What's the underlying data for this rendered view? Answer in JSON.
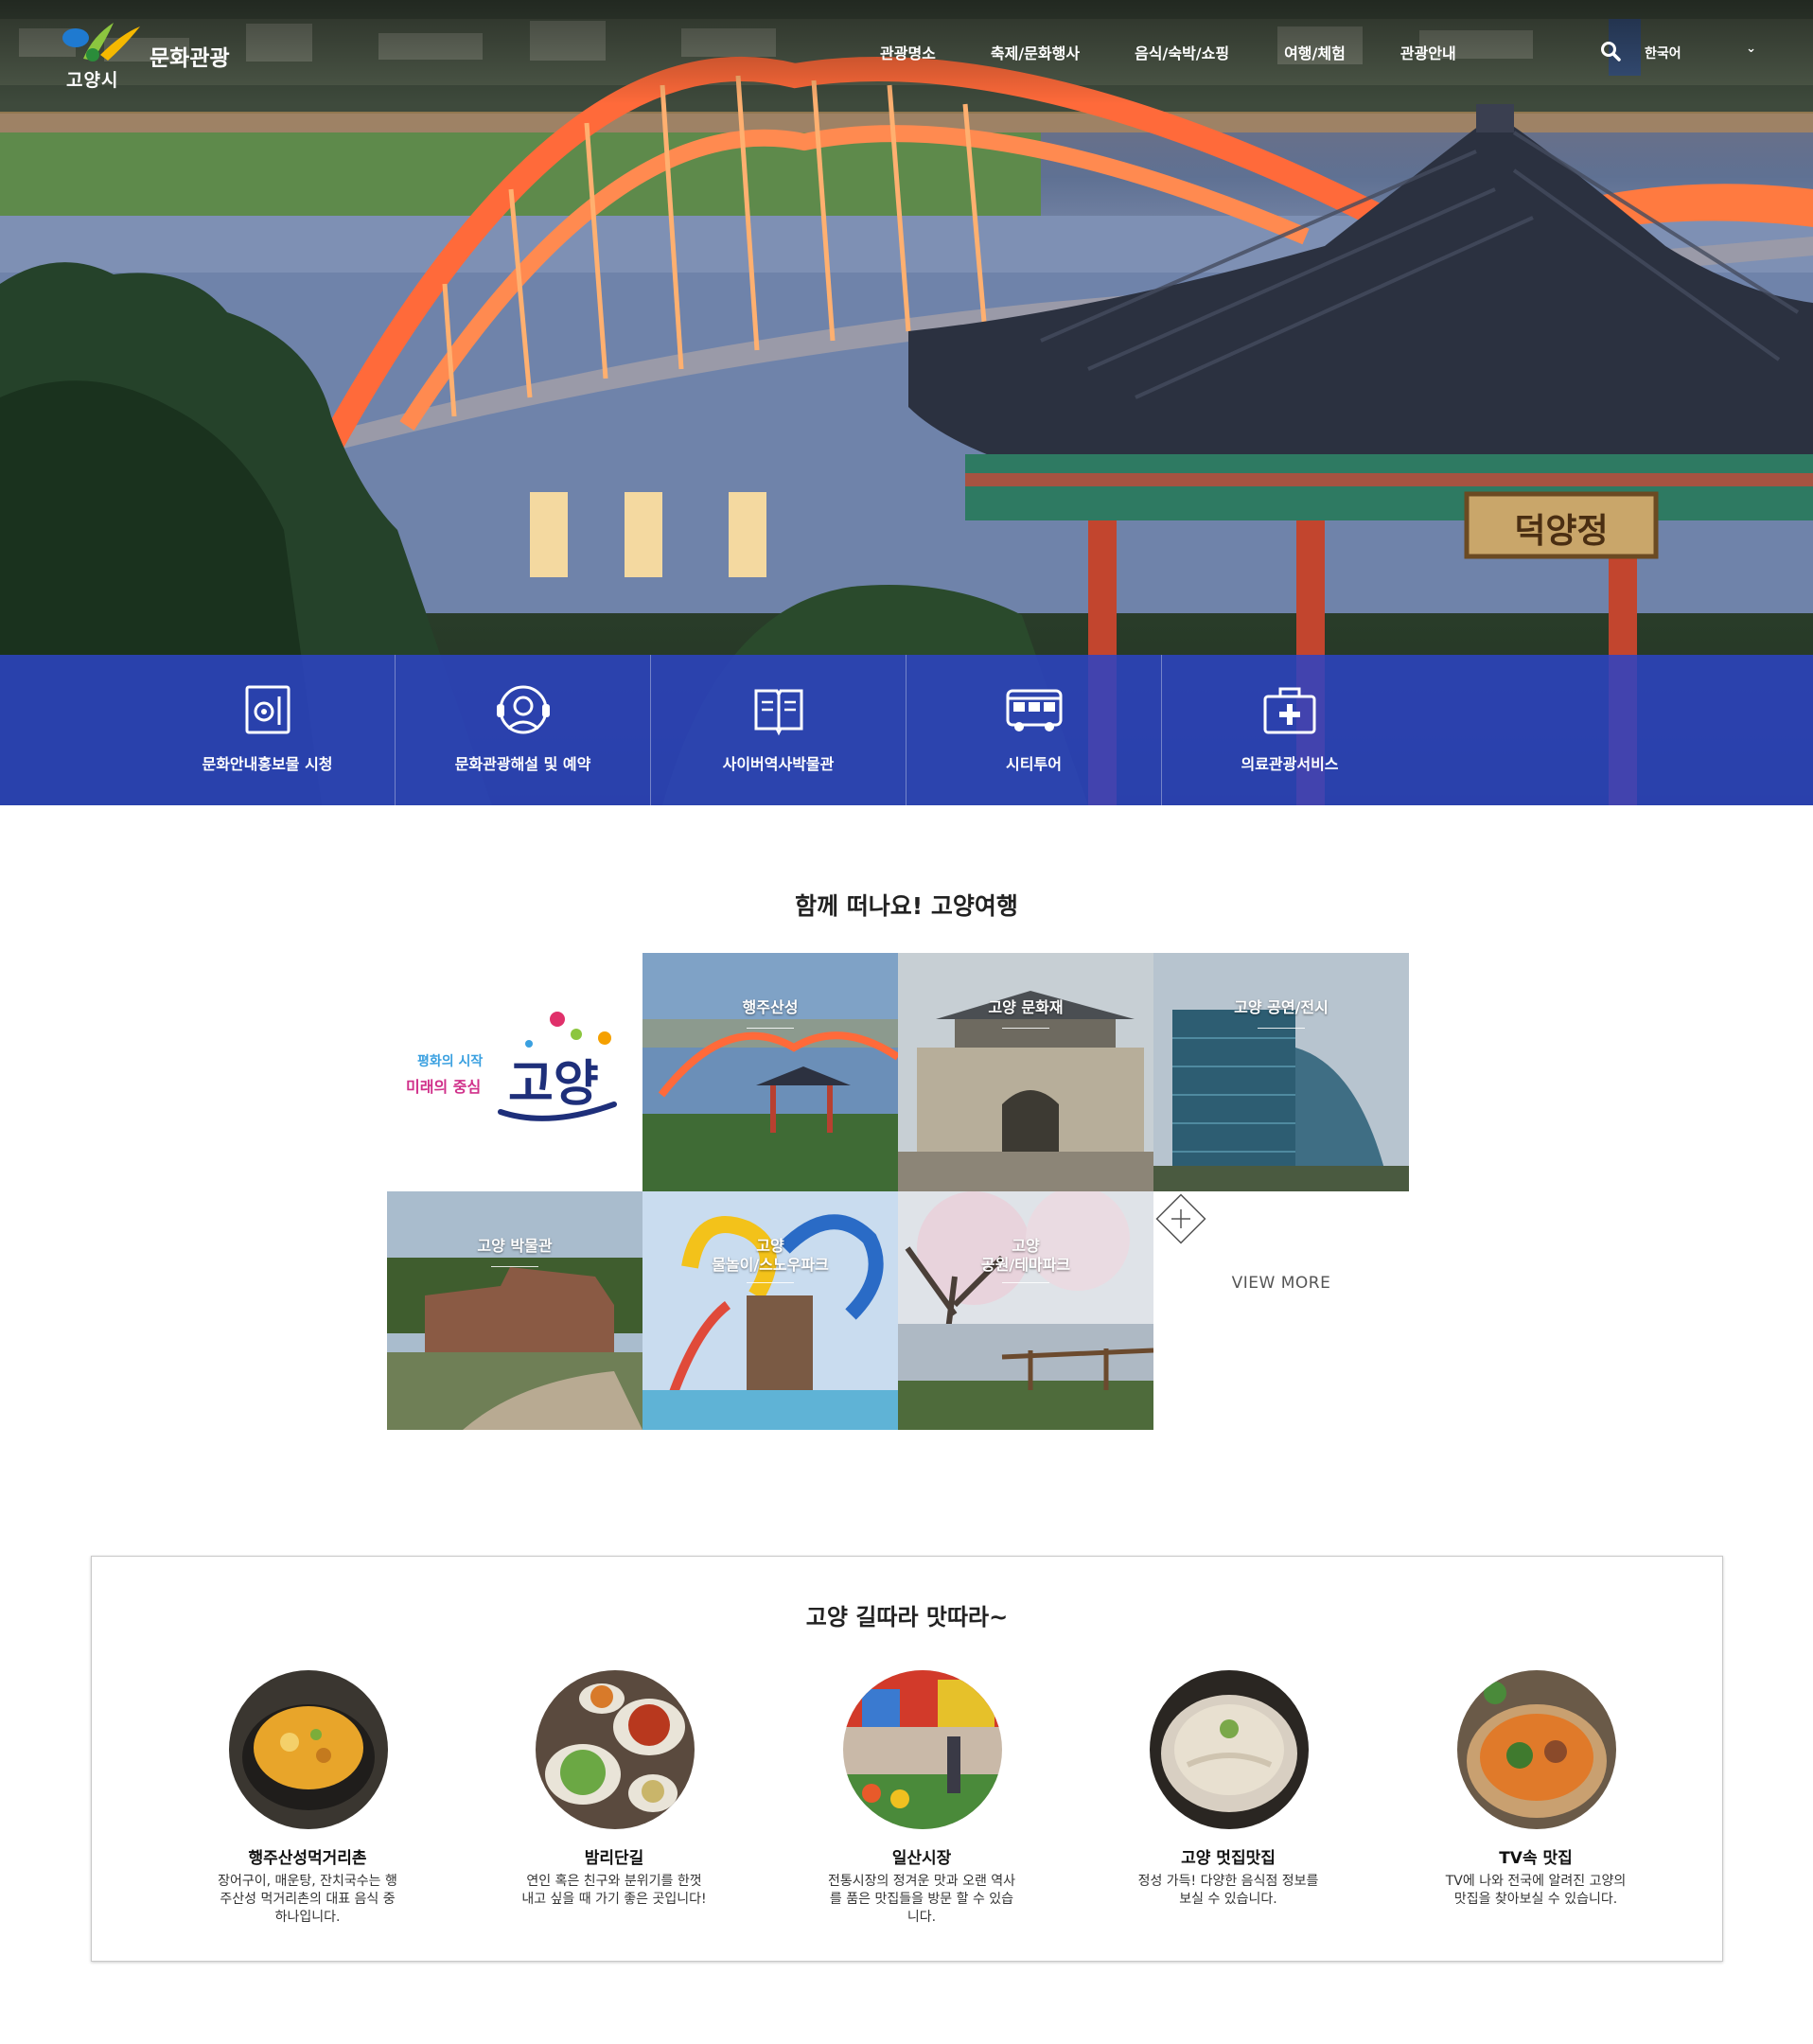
{
  "header": {
    "logo_city": "고양시",
    "site_title": "문화관광",
    "nav": [
      "관광명소",
      "축제/문화행사",
      "음식/숙박/쇼핑",
      "여행/체험",
      "관광안내"
    ],
    "language": "한국어"
  },
  "hero": {
    "sign_text": "덕양정"
  },
  "quick_menu": [
    {
      "label": "문화안내홍보물 시청",
      "icon": "brochure-icon"
    },
    {
      "label": "문화관광해설 및 예약",
      "icon": "guide-headset-icon"
    },
    {
      "label": "사이버역사박물관",
      "icon": "book-icon"
    },
    {
      "label": "시티투어",
      "icon": "bus-icon"
    },
    {
      "label": "의료관광서비스",
      "icon": "medical-kit-icon"
    }
  ],
  "travel": {
    "title": "함께 떠나요! 고양여행",
    "brand": {
      "line1": "평화의 시작",
      "line2": "미래의 중심",
      "name": "고양"
    },
    "tiles": [
      {
        "label": "행주산성"
      },
      {
        "label": "고양 문화재"
      },
      {
        "label": "고양 공연/전시"
      },
      {
        "label": "고양 박물관"
      },
      {
        "label": "고양\n물놀이/스노우파크"
      },
      {
        "label": "고양\n공원/테마파크"
      }
    ],
    "view_more": "VIEW MORE"
  },
  "food": {
    "title": "고양 길따라 맛따라~",
    "items": [
      {
        "name": "행주산성먹거리촌",
        "desc": "장어구이, 매운탕, 잔치국수는 행주산성 먹거리촌의 대표 음식 중 하나입니다."
      },
      {
        "name": "밤리단길",
        "desc": "연인 혹은 친구와 분위기를 한껏 내고 싶을 때 가기 좋은 곳입니다!"
      },
      {
        "name": "일산시장",
        "desc": "전통시장의 정겨운 맛과 오랜 역사를 품은 맛집들을 방문 할 수 있습니다."
      },
      {
        "name": "고양 멋집맛집",
        "desc": "정성 가득! 다양한 음식점 정보를 보실 수 있습니다."
      },
      {
        "name": "TV속 맛집",
        "desc": "TV에 나와 전국에 알려진 고양의 맛집을 찾아보실 수 있습니다."
      }
    ]
  },
  "colors": {
    "quick_menu_bg": "#2c44c4",
    "bridge": "#ff6a3a",
    "roof": "#2b3140"
  }
}
